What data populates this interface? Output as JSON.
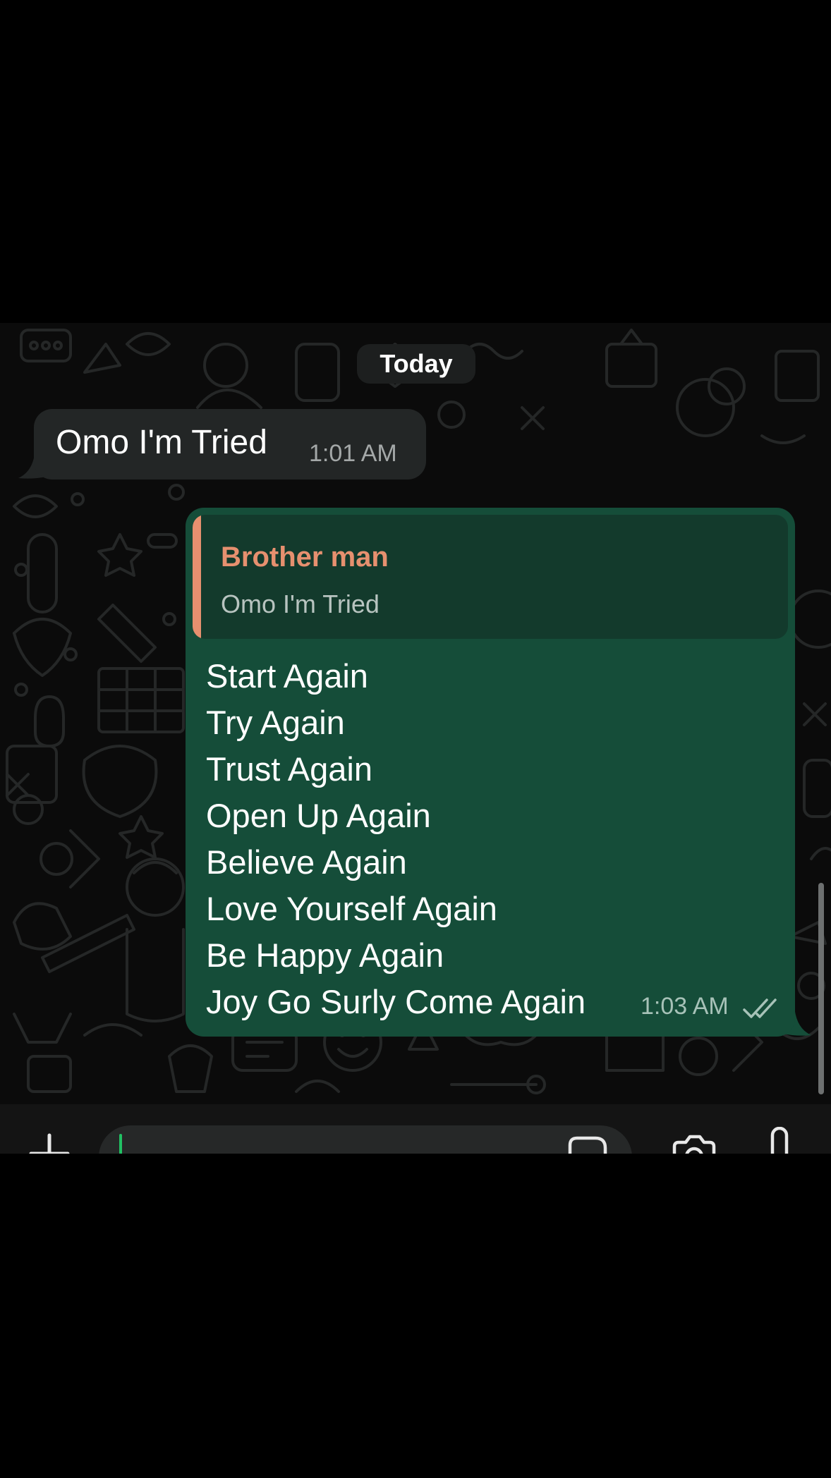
{
  "chat": {
    "date_label": "Today",
    "incoming": {
      "text": "Omo I'm Tried",
      "time": "1:01 AM"
    },
    "outgoing": {
      "reply_to": {
        "author": "Brother man",
        "text": "Omo I'm Tried"
      },
      "lines": [
        "Start Again",
        "Try Again",
        "Trust Again",
        "Open Up Again",
        "Believe Again",
        "Love Yourself Again",
        "Be Happy Again",
        "Joy Go Surly Come Again"
      ],
      "time": "1:03 AM",
      "status": "read"
    }
  },
  "composer": {
    "left_icon": "plus-icon",
    "right_icons": [
      "sticker-icon",
      "camera-icon",
      "microphone-icon"
    ]
  },
  "colors": {
    "outgoing_bubble": "#154d39",
    "incoming_bubble": "#232626",
    "quote_accent": "#e6906f",
    "cursor": "#21c063"
  }
}
